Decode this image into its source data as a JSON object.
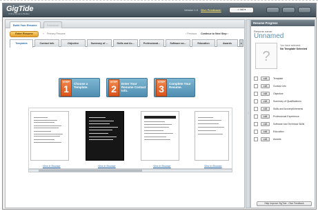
{
  "header": {
    "logo": "GigTide",
    "logo_sub": "Online Resume Builder",
    "version": "Version 1.0",
    "feedback_link": "Give Feedback!",
    "account_btn": "☺ tdd ▾",
    "buttons": [
      "",
      "",
      ""
    ]
  },
  "top_tabs": [
    "Build Your Resume",
    "Download"
  ],
  "nav": {
    "start_button": "Enter Resume",
    "prev_label": "Primary Resume",
    "previous": "‹ Previous",
    "next": "Continue to Next Step ›"
  },
  "section_tabs": [
    "Templates",
    "Contact Info",
    "Objective",
    "Summary of ...",
    "Skills and Ac...",
    "Professional...",
    "Software an...",
    "Education",
    "Awards"
  ],
  "steps": [
    {
      "label": "STEP",
      "num": "1",
      "text": "Choose a Template."
    },
    {
      "label": "STEP",
      "num": "2",
      "text": "Enter Your Resume Contact Info."
    },
    {
      "label": "STEP",
      "num": "3",
      "text": "Complete Your Resume."
    }
  ],
  "gallery": {
    "view_label": "View in Browser"
  },
  "right": {
    "header": "Resume Progress",
    "name_label": "Resume name:",
    "name": "Unnamed",
    "avatar_glyph": "?",
    "selected_label": "You have selected:",
    "selected_value": "No Template Selected",
    "edit_label": "edit",
    "items": [
      "Template",
      "Contact Info",
      "Objective",
      "Summary of Qualifications",
      "Skills and Accomplishments",
      "Professional Experience",
      "Software and Technical Skills",
      "Education",
      "Awards"
    ],
    "improve_button": "Help Improve GigTide - Give Feedback"
  },
  "colors": {
    "accent_blue": "#2a6aa8",
    "step_blue": "#4f8db0",
    "step_orange": "#d9531b",
    "header_dark": "#43505a"
  }
}
